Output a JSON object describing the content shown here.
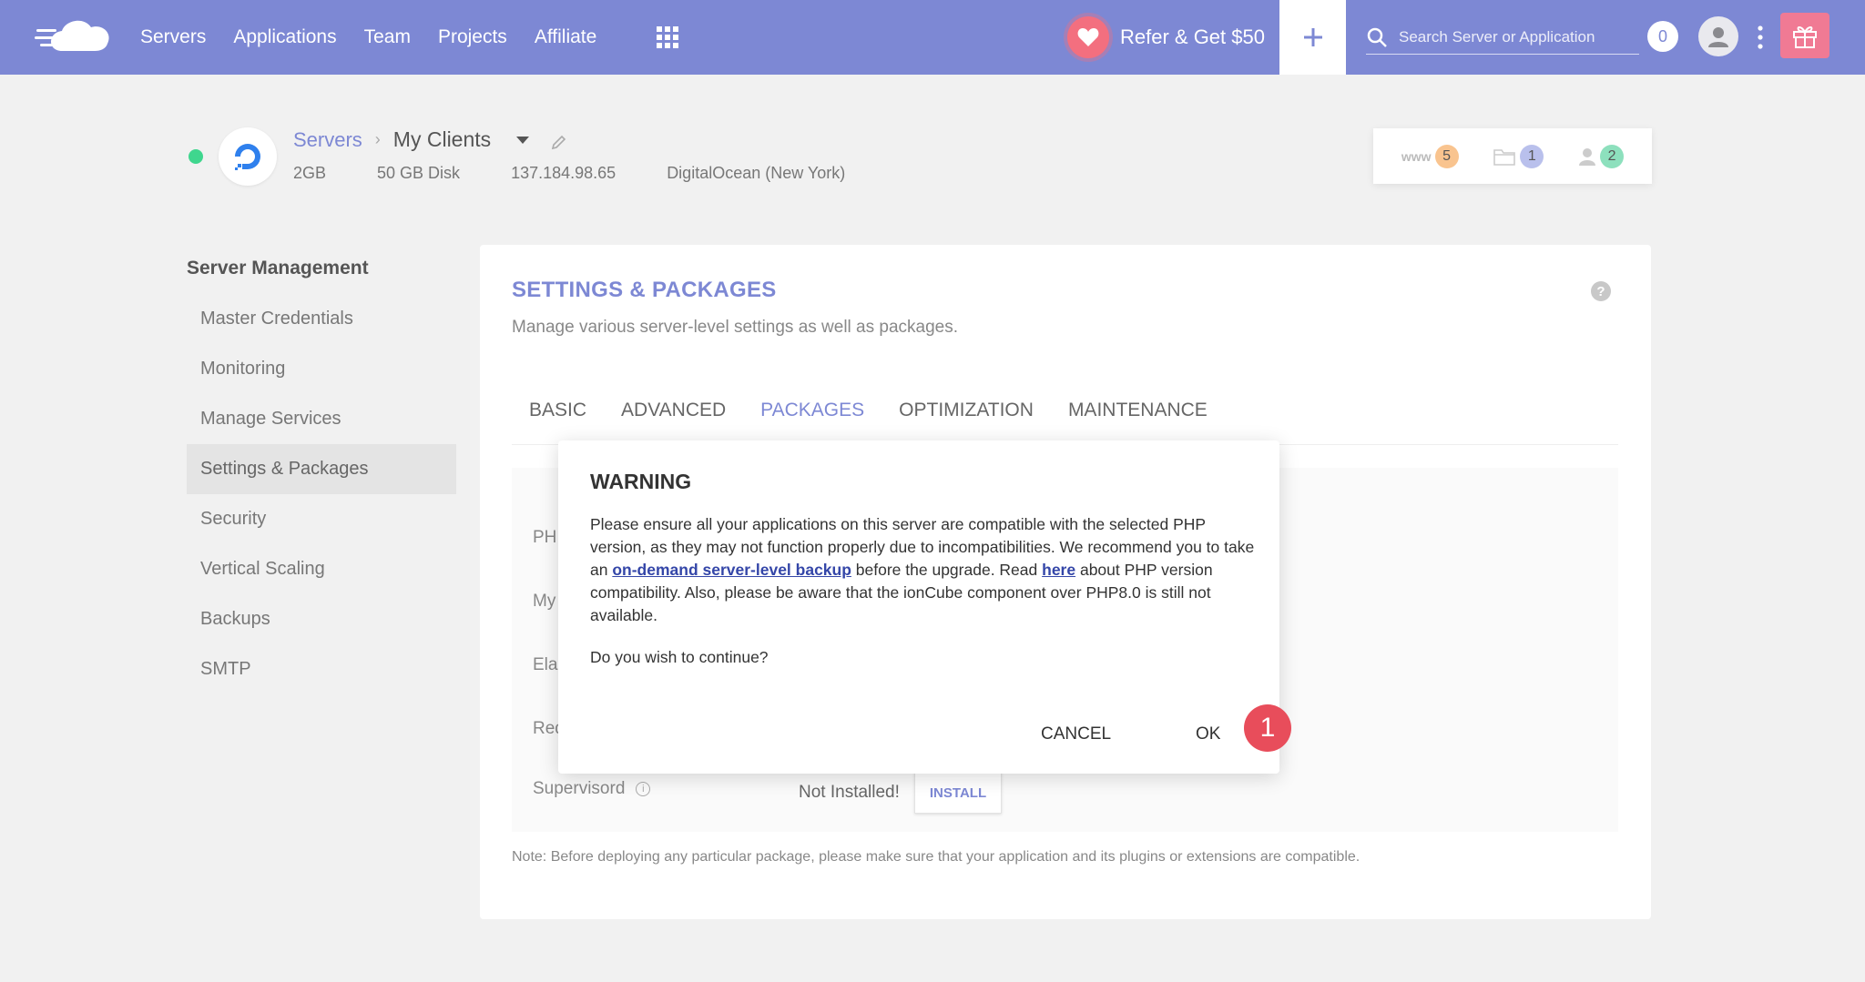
{
  "topbar": {
    "nav": [
      "Servers",
      "Applications",
      "Team",
      "Projects",
      "Affiliate"
    ],
    "refer_label": "Refer & Get $50",
    "search_placeholder": "Search Server or Application",
    "notifications": "0",
    "accent": "#7d88d4"
  },
  "server": {
    "crumb_root": "Servers",
    "name": "My Clients",
    "ram": "2GB",
    "disk": "50 GB Disk",
    "ip": "137.184.98.65",
    "provider": "DigitalOcean (New York)",
    "counters": {
      "www_label": "www",
      "www": "5",
      "files": "1",
      "users": "2"
    }
  },
  "sidebar": {
    "title": "Server Management",
    "items": [
      "Master Credentials",
      "Monitoring",
      "Manage Services",
      "Settings & Packages",
      "Security",
      "Vertical Scaling",
      "Backups",
      "SMTP"
    ],
    "active_index": 3
  },
  "main": {
    "title": "SETTINGS & PACKAGES",
    "subtitle": "Manage various server-level settings as well as packages.",
    "tabs": [
      "BASIC",
      "ADVANCED",
      "PACKAGES",
      "OPTIMIZATION",
      "MAINTENANCE"
    ],
    "active_tab": 2,
    "package_labels": [
      "PH",
      "My",
      "Ela",
      "Red"
    ],
    "supervisord": {
      "label": "Supervisord",
      "status": "Not Installed!",
      "button": "INSTALL"
    },
    "note": "Note: Before deploying any particular package, please make sure that your application and its plugins or extensions are compatible."
  },
  "modal": {
    "title": "WARNING",
    "body_1": "Please ensure all your applications on this server are compatible with the selected PHP version, as they may not function properly due to incompatibilities. We recommend you to take an ",
    "link_1": "on-demand server-level backup",
    "body_2": " before the upgrade. Read ",
    "link_2": "here",
    "body_3": " about PHP version compatibility. Also, please be aware that the ionCube component over PHP8.0 is still not available.",
    "question": "Do you wish to continue?",
    "cancel": "CANCEL",
    "ok": "OK"
  },
  "annotation": {
    "step": "1"
  }
}
